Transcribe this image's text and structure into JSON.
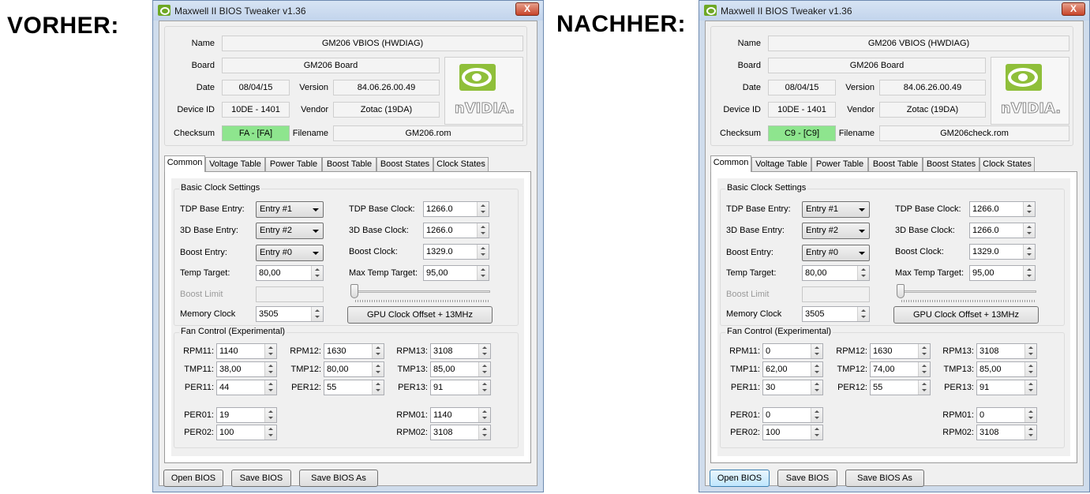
{
  "labels": {
    "before": "VORHER:",
    "after": "NACHHER:"
  },
  "window": {
    "title": "Maxwell II BIOS Tweaker v1.36",
    "close": "X"
  },
  "fields": {
    "name": "Name",
    "board": "Board",
    "date": "Date",
    "version": "Version",
    "device_id": "Device ID",
    "vendor": "Vendor",
    "checksum": "Checksum",
    "filename": "Filename"
  },
  "logo_text": "nVIDIA.",
  "tabs": [
    "Common",
    "Voltage Table",
    "Power Table",
    "Boost Table",
    "Boost States",
    "Clock States"
  ],
  "basic": {
    "group_title": "Basic Clock Settings",
    "tdp_base_entry": "TDP Base Entry:",
    "base_3d_entry": "3D Base Entry:",
    "boost_entry": "Boost Entry:",
    "temp_target": "Temp Target:",
    "boost_limit": "Boost Limit",
    "memory_clock": "Memory Clock",
    "tdp_base_clock": "TDP Base Clock:",
    "base_3d_clock": "3D Base Clock:",
    "boost_clock": "Boost Clock:",
    "max_temp_target": "Max Temp Target:",
    "offset_button": "GPU Clock Offset + 13MHz"
  },
  "fan": {
    "group_title": "Fan Control (Experimental)",
    "rpm11": "RPM11:",
    "rpm12": "RPM12:",
    "rpm13": "RPM13:",
    "tmp11": "TMP11:",
    "tmp12": "TMP12:",
    "tmp13": "TMP13:",
    "per11": "PER11:",
    "per12": "PER12:",
    "per13": "PER13:",
    "per01": "PER01:",
    "per02": "PER02:",
    "rpm01": "RPM01:",
    "rpm02": "RPM02:"
  },
  "buttons": {
    "open": "Open BIOS",
    "save": "Save BIOS",
    "save_as": "Save BIOS As"
  },
  "before": {
    "name": "GM206 VBIOS (HWDIAG)",
    "board": "GM206 Board",
    "date": "08/04/15",
    "version": "84.06.26.00.49",
    "device_id": "10DE - 1401",
    "vendor": "Zotac (19DA)",
    "checksum": "FA - [FA]",
    "filename": "GM206.rom",
    "tdp_entry": "Entry #1",
    "base3d_entry": "Entry #2",
    "boost_entry": "Entry #0",
    "temp_target": "80,00",
    "boost_limit": "",
    "memory_clock": "3505",
    "tdp_clock": "1266.0",
    "base3d_clock": "1266.0",
    "boost_clock": "1329.0",
    "max_temp": "95,00",
    "rpm11": "1140",
    "rpm12": "1630",
    "rpm13": "3108",
    "tmp11": "38,00",
    "tmp12": "80,00",
    "tmp13": "85,00",
    "per11": "44",
    "per12": "55",
    "per13": "91",
    "per01": "19",
    "per02": "100",
    "rpm01": "1140",
    "rpm02": "3108"
  },
  "after": {
    "name": "GM206 VBIOS (HWDIAG)",
    "board": "GM206 Board",
    "date": "08/04/15",
    "version": "84.06.26.00.49",
    "device_id": "10DE - 1401",
    "vendor": "Zotac (19DA)",
    "checksum": "C9 - [C9]",
    "filename": "GM206check.rom",
    "tdp_entry": "Entry #1",
    "base3d_entry": "Entry #2",
    "boost_entry": "Entry #0",
    "temp_target": "80,00",
    "boost_limit": "",
    "memory_clock": "3505",
    "tdp_clock": "1266.0",
    "base3d_clock": "1266.0",
    "boost_clock": "1329.0",
    "max_temp": "95,00",
    "rpm11": "0",
    "rpm12": "1630",
    "rpm13": "3108",
    "tmp11": "62,00",
    "tmp12": "74,00",
    "tmp13": "85,00",
    "per11": "30",
    "per12": "55",
    "per13": "91",
    "per01": "0",
    "per02": "100",
    "rpm01": "0",
    "rpm02": "3108"
  },
  "colors": {
    "checksum_ok": "#8ee58e",
    "nvidia_green": "#76b900"
  }
}
